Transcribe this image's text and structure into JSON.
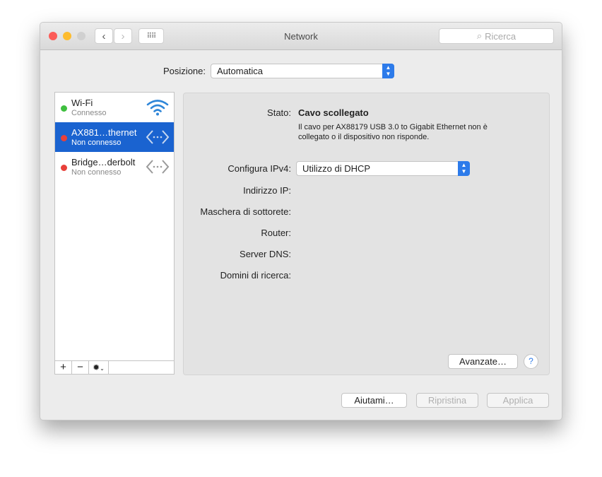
{
  "window": {
    "title": "Network",
    "search_placeholder": "Ricerca"
  },
  "location": {
    "label": "Posizione:",
    "value": "Automatica"
  },
  "services": [
    {
      "name": "Wi-Fi",
      "status": "Connesso",
      "status_color": "#3fbf3f",
      "icon": "wifi-icon"
    },
    {
      "name": "AX881…thernet",
      "status": "Non connesso",
      "status_color": "#e8403a",
      "icon": "ethernet-icon",
      "selected": true
    },
    {
      "name": "Bridge…derbolt",
      "status": "Non connesso",
      "status_color": "#e8403a",
      "icon": "ethernet-icon"
    }
  ],
  "sidebar_tools": {
    "add": "+",
    "remove": "−"
  },
  "detail": {
    "status_label": "Stato:",
    "status_value": "Cavo scollegato",
    "status_desc": "Il cavo per AX88179 USB 3.0 to Gigabit Ethernet non è collegato o il dispositivo non risponde.",
    "ipv4_label": "Configura IPv4:",
    "ipv4_value": "Utilizzo di DHCP",
    "fields": [
      "Indirizzo IP:",
      "Maschera di sottorete:",
      "Router:",
      "Server DNS:",
      "Domini di ricerca:"
    ],
    "advanced": "Avanzate…",
    "help": "?"
  },
  "footer": {
    "assist": "Aiutami…",
    "revert": "Ripristina",
    "apply": "Applica"
  }
}
